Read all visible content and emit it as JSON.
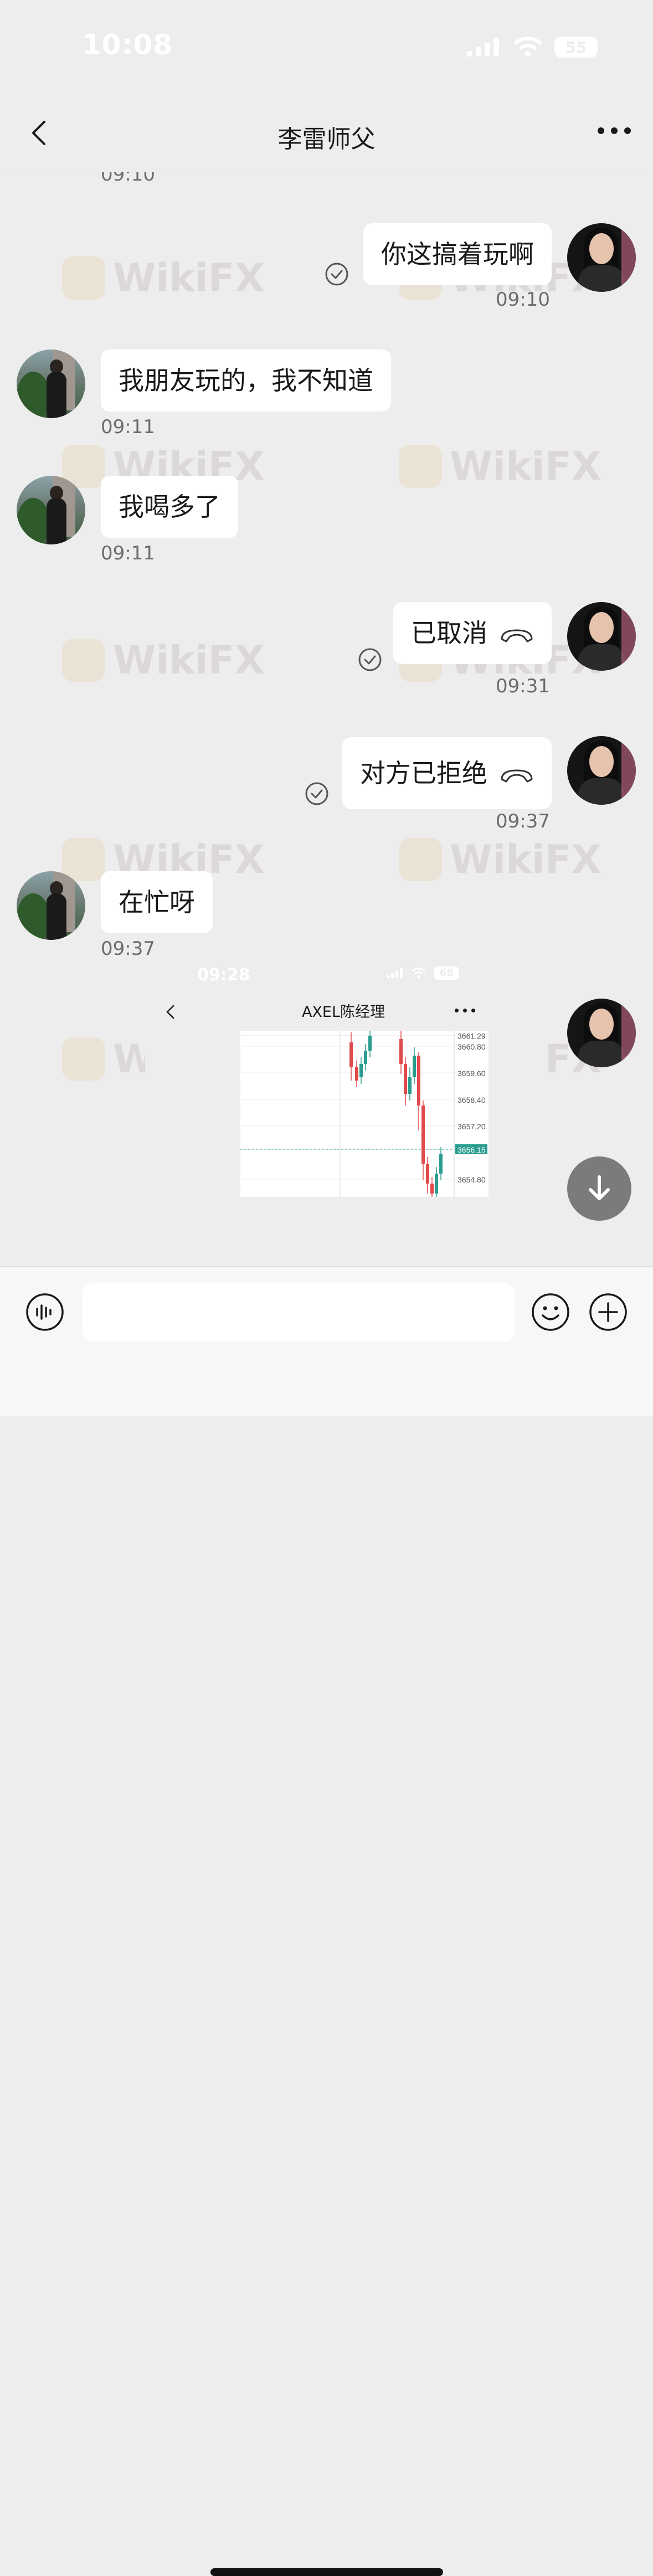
{
  "status_bar": {
    "time": "10:08",
    "battery": "55"
  },
  "header": {
    "title": "李雷师父"
  },
  "messages": [
    {
      "side": "in",
      "time": "09:10"
    },
    {
      "side": "out",
      "text": "你这搞着玩啊",
      "time": "09:10",
      "read": true
    },
    {
      "side": "in",
      "text": "我朋友玩的，我不知道",
      "time": "09:11"
    },
    {
      "side": "in",
      "text": "我喝多了",
      "time": "09:11"
    },
    {
      "side": "out",
      "text": "已取消",
      "call_icon": "phone-hangup-icon",
      "time": "09:31",
      "read": true
    },
    {
      "side": "out",
      "text": "对方已拒绝",
      "call_icon": "phone-hangup-icon",
      "time": "09:37",
      "read": true
    },
    {
      "side": "in",
      "text": "在忙呀",
      "time": "09:37"
    }
  ],
  "image_message": {
    "status_time": "09:28",
    "status_battery": "68",
    "chat_title": "AXEL陈经理",
    "chart_data": {
      "type": "candlestick",
      "y_ticks": [
        "3661.29",
        "3660.80",
        "3659.60",
        "3658.40",
        "3657.20",
        "3656.15",
        "3654.80"
      ],
      "current_price": "3656.15",
      "ylim": [
        3654.0,
        3661.5
      ]
    }
  },
  "watermark": "WikiFX",
  "input": {
    "value": "",
    "placeholder": ""
  },
  "icons": {
    "back": "chevron-left-icon",
    "more": "ellipsis-icon",
    "voice": "voice-wave-icon",
    "emoji": "smiley-icon",
    "plus": "plus-circle-icon",
    "scroll_down": "arrow-down-icon",
    "read": "check-circle-icon"
  },
  "colors": {
    "background": "#ededed",
    "bubble": "#ffffff",
    "fab": "#7b7b7b",
    "candle_up": "#2a9d8f",
    "candle_down": "#e04a4a"
  }
}
